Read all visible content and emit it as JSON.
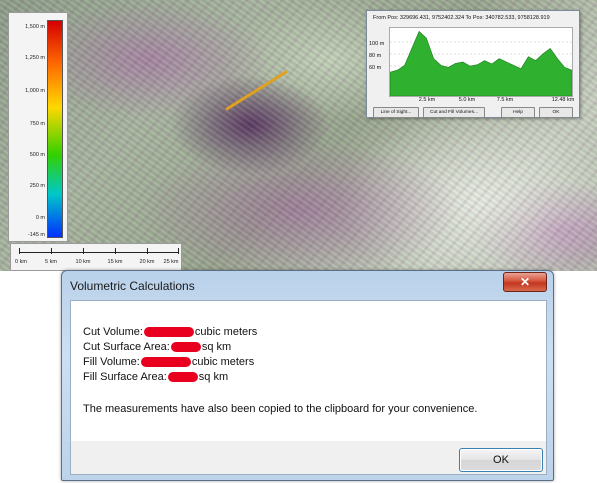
{
  "map": {
    "legend": {
      "ticks": [
        "1,500 m",
        "1,250 m",
        "1,000 m",
        "750 m",
        "500 m",
        "250 m",
        "0 m",
        "-145 m"
      ]
    },
    "scale_bar": {
      "labels": [
        "0 km",
        "5 km",
        "10 km",
        "15 km",
        "20 km",
        "25 km"
      ]
    },
    "profile_window": {
      "title": "From Pos: 329696.431, 9752402.324 To Pos: 340782.533, 9758128.919",
      "y_labels": [
        "100 m",
        "80 m",
        "60 m"
      ],
      "x_labels": [
        "2.5 km",
        "5.0 km",
        "7.5 km",
        "12.48 km"
      ],
      "profile_fraction": [
        0.35,
        0.38,
        0.45,
        0.7,
        0.95,
        0.85,
        0.55,
        0.45,
        0.42,
        0.48,
        0.5,
        0.44,
        0.46,
        0.52,
        0.47,
        0.55,
        0.5,
        0.45,
        0.4,
        0.58,
        0.52,
        0.62,
        0.7,
        0.55,
        0.42,
        0.38
      ],
      "buttons": {
        "line_of_sight": "Line of Sight...",
        "cut_fill": "Cut and Fill Volumes...",
        "help": "Help",
        "ok": "OK"
      },
      "fill_color": "#2fb02f"
    }
  },
  "dialog": {
    "title": "Volumetric Calculations",
    "close_glyph": "✕",
    "measurements": [
      {
        "label": "Cut Volume:",
        "unit": "cubic meters"
      },
      {
        "label": "Cut Surface Area:",
        "unit": " sq km"
      },
      {
        "label": "Fill Volume:",
        "unit": "cubic meters"
      },
      {
        "label": "Fill Surface Area:",
        "unit": "sq km"
      }
    ],
    "notice": "The measurements have also been copied to the clipboard for your convenience.",
    "ok_label": "OK",
    "redaction_color": "#e8001e"
  }
}
